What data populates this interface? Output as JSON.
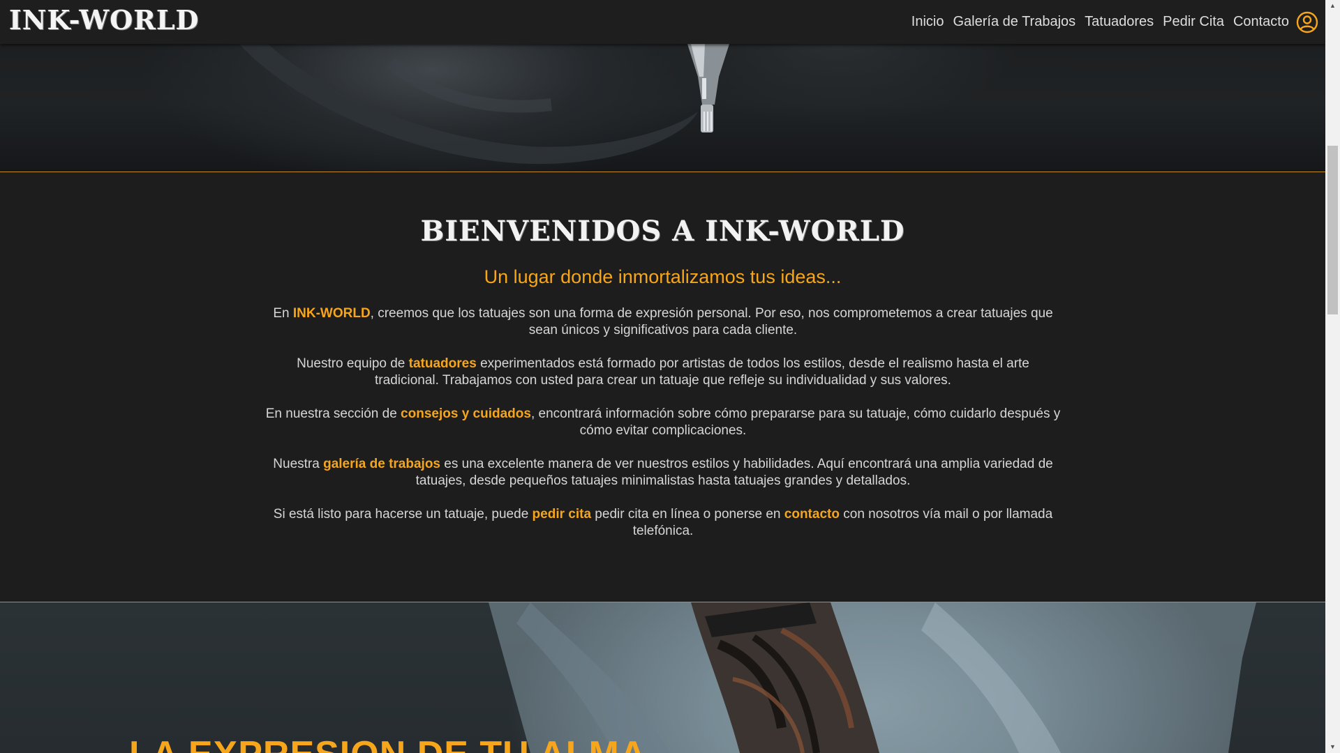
{
  "brand": "INK-WORLD",
  "nav": {
    "items": [
      "Inicio",
      "Galería de Trabajos",
      "Tatuadores",
      "Pedir Cita",
      "Contacto"
    ],
    "user_icon": "user-circle-icon"
  },
  "welcome": {
    "title": "BIENVENIDOS A INK-WORLD",
    "subtitle": "Un lugar donde inmortalizamos tus ideas...",
    "paragraphs": [
      [
        {
          "t": "En ",
          "h": false
        },
        {
          "t": "INK-WORLD",
          "h": true
        },
        {
          "t": ", creemos que los tatuajes son una forma de expresión personal. Por eso, nos comprometemos a crear tatuajes que sean únicos y significativos para cada cliente.",
          "h": false
        }
      ],
      [
        {
          "t": "Nuestro equipo de ",
          "h": false
        },
        {
          "t": "tatuadores",
          "h": true
        },
        {
          "t": " experimentados está formado por artistas de todos los estilos, desde el realismo hasta el arte tradicional. Trabajamos con usted para crear un tatuaje que refleje su individualidad y sus valores.",
          "h": false
        }
      ],
      [
        {
          "t": "En nuestra sección de ",
          "h": false
        },
        {
          "t": "consejos y cuidados",
          "h": true
        },
        {
          "t": ", encontrará información sobre cómo prepararse para su tatuaje, cómo cuidarlo después y cómo evitar complicaciones.",
          "h": false
        }
      ],
      [
        {
          "t": "Nuestra ",
          "h": false
        },
        {
          "t": "galería de trabajos",
          "h": true
        },
        {
          "t": " es una excelente manera de ver nuestros estilos y habilidades. Aquí encontrará una amplia variedad de tatuajes, desde pequeños tatuajes minimalistas hasta tatuajes grandes y detallados.",
          "h": false
        }
      ],
      [
        {
          "t": "Si está listo para hacerse un tatuaje, puede ",
          "h": false
        },
        {
          "t": "pedir cita",
          "h": true
        },
        {
          "t": " pedir cita en línea o ponerse en ",
          "h": false
        },
        {
          "t": "contacto",
          "h": true
        },
        {
          "t": " con nosotros vía mail o por llamada telefónica.",
          "h": false
        }
      ]
    ]
  },
  "hero_bottom": {
    "title": "LA EXPRESION DE TU ALMA"
  },
  "colors": {
    "accent": "#f7a61b",
    "background": "#1d1d1d",
    "navbar": "#1e1e1e",
    "divider": "#c58a21"
  }
}
